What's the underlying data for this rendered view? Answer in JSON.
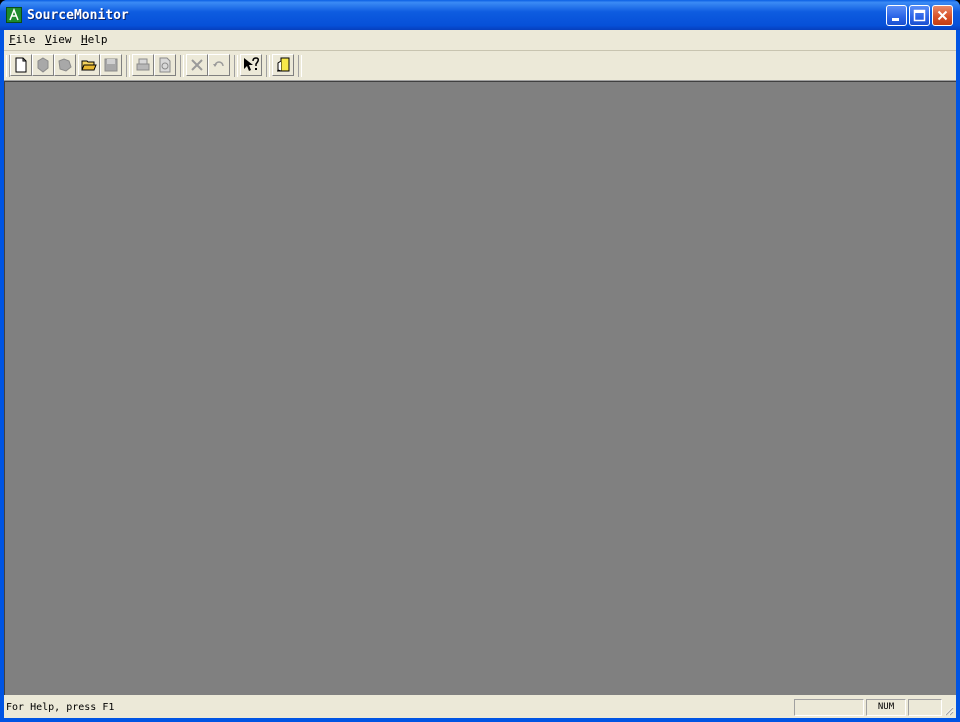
{
  "window": {
    "title": "SourceMonitor",
    "controls": {
      "minimize": "minimize",
      "maximize": "maximize",
      "close": "close"
    }
  },
  "menubar": {
    "items": [
      {
        "label": "File"
      },
      {
        "label": "View"
      },
      {
        "label": "Help"
      }
    ]
  },
  "toolbar": {
    "buttons": [
      {
        "icon": "new-document-icon",
        "enabled": true
      },
      {
        "icon": "checkpoint-icon",
        "enabled": false
      },
      {
        "icon": "metrics-icon",
        "enabled": false
      },
      {
        "icon": "open-folder-icon",
        "enabled": true
      },
      {
        "icon": "save-disk-icon",
        "enabled": false
      },
      {
        "icon": "print-icon",
        "enabled": false
      },
      {
        "icon": "print-preview-icon",
        "enabled": false
      },
      {
        "icon": "delete-x-icon",
        "enabled": false
      },
      {
        "icon": "refresh-icon",
        "enabled": false
      },
      {
        "icon": "context-help-icon",
        "enabled": true
      },
      {
        "icon": "exit-door-icon",
        "enabled": true
      }
    ]
  },
  "statusbar": {
    "message": "For Help, press F1",
    "num_indicator": "NUM"
  },
  "colors": {
    "titlebar": "#0054e3",
    "client_background": "#808080",
    "chrome": "#ece9d8"
  }
}
